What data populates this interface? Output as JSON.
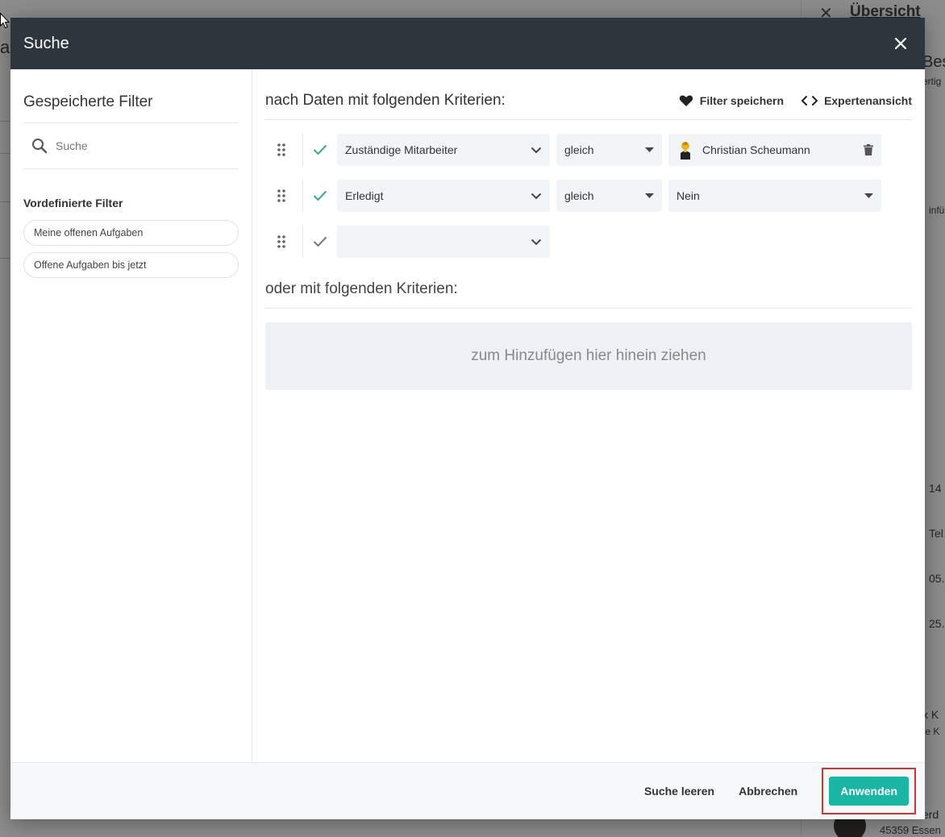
{
  "background": {
    "right_panel_title": "Übersicht",
    "fragments": [
      "Bes",
      "ertig",
      "A",
      "infü",
      "14",
      "Tel",
      "05.",
      "25.",
      "x K",
      "te K",
      "erd",
      "45359 Essen",
      "a"
    ]
  },
  "modal": {
    "title": "Suche",
    "close_label": "Schließen"
  },
  "sidebar": {
    "title": "Gespeicherte Filter",
    "search_placeholder": "Suche",
    "predefined_label": "Vordefinierte Filter",
    "predefined_filters": [
      "Meine offenen Aufgaben",
      "Offene Aufgaben bis jetzt"
    ]
  },
  "main": {
    "and_title": "nach Daten mit folgenden Kriterien:",
    "save_filter_label": "Filter speichern",
    "expert_view_label": "Expertenansicht",
    "criteria": [
      {
        "field": "Zuständige Mitarbeiter",
        "operator": "gleich",
        "value": "Christian Scheumann",
        "active": true
      },
      {
        "field": "Erledigt",
        "operator": "gleich",
        "value": "Nein",
        "active": true
      },
      {
        "field": "",
        "active": false
      }
    ],
    "or_title": "oder mit folgenden Kriterien:",
    "dropzone_text": "zum Hinzufügen hier hinein ziehen"
  },
  "footer": {
    "clear_label": "Suche leeren",
    "cancel_label": "Abbrechen",
    "apply_label": "Anwenden"
  },
  "colors": {
    "header_bg": "#2e363d",
    "accent": "#1ab5a3",
    "check_active": "#3aa88f",
    "highlight_border": "#d63333"
  }
}
